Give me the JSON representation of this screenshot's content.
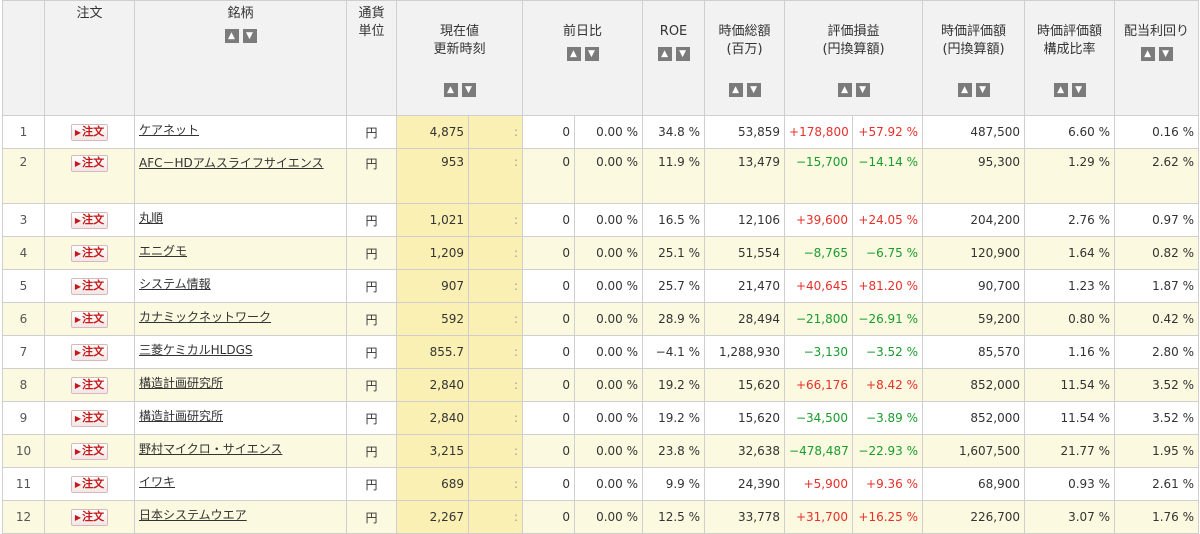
{
  "headers": {
    "order": "注文",
    "name": "銘柄",
    "currency": "通貨\n単位",
    "price": "現在値\n更新時刻",
    "change": "前日比",
    "roe": "ROE",
    "mktcap": "時価総額\n(百万)",
    "pnl": "評価損益\n(円換算額)",
    "valuation": "時価評価額\n(円換算額)",
    "ratio": "時価評価額\n構成比率",
    "dividend": "配当利回り"
  },
  "order_label": "注文",
  "currency_label": "円",
  "time_placeholder": ":",
  "rows": [
    {
      "idx": "1",
      "name": "ケアネット",
      "price": "4,875",
      "chg": "0",
      "chgpct": "0.00 %",
      "roe": "34.8 %",
      "cap": "53,859",
      "pnl": "+178,800",
      "pnlpct": "+57.92 %",
      "pnlsign": "pos",
      "val": "487,500",
      "ratio": "6.60 %",
      "div": "0.16 %"
    },
    {
      "idx": "2",
      "name": "AFC－HDアムスライフサイエンス",
      "price": "953",
      "chg": "0",
      "chgpct": "0.00 %",
      "roe": "11.9 %",
      "cap": "13,479",
      "pnl": "−15,700",
      "pnlpct": "−14.14 %",
      "pnlsign": "neg",
      "val": "95,300",
      "ratio": "1.29 %",
      "div": "2.62 %"
    },
    {
      "idx": "3",
      "name": "丸順",
      "price": "1,021",
      "chg": "0",
      "chgpct": "0.00 %",
      "roe": "16.5 %",
      "cap": "12,106",
      "pnl": "+39,600",
      "pnlpct": "+24.05 %",
      "pnlsign": "pos",
      "val": "204,200",
      "ratio": "2.76 %",
      "div": "0.97 %"
    },
    {
      "idx": "4",
      "name": "エニグモ",
      "price": "1,209",
      "chg": "0",
      "chgpct": "0.00 %",
      "roe": "25.1 %",
      "cap": "51,554",
      "pnl": "−8,765",
      "pnlpct": "−6.75 %",
      "pnlsign": "neg",
      "val": "120,900",
      "ratio": "1.64 %",
      "div": "0.82 %"
    },
    {
      "idx": "5",
      "name": "システム情報",
      "price": "907",
      "chg": "0",
      "chgpct": "0.00 %",
      "roe": "25.7 %",
      "cap": "21,470",
      "pnl": "+40,645",
      "pnlpct": "+81.20 %",
      "pnlsign": "pos",
      "val": "90,700",
      "ratio": "1.23 %",
      "div": "1.87 %"
    },
    {
      "idx": "6",
      "name": "カナミックネットワーク",
      "price": "592",
      "chg": "0",
      "chgpct": "0.00 %",
      "roe": "28.9 %",
      "cap": "28,494",
      "pnl": "−21,800",
      "pnlpct": "−26.91 %",
      "pnlsign": "neg",
      "val": "59,200",
      "ratio": "0.80 %",
      "div": "0.42 %"
    },
    {
      "idx": "7",
      "name": "三菱ケミカルHLDGS",
      "price": "855.7",
      "chg": "0",
      "chgpct": "0.00 %",
      "roe": "−4.1 %",
      "cap": "1,288,930",
      "pnl": "−3,130",
      "pnlpct": "−3.52 %",
      "pnlsign": "neg",
      "val": "85,570",
      "ratio": "1.16 %",
      "div": "2.80 %"
    },
    {
      "idx": "8",
      "name": "構造計画研究所",
      "price": "2,840",
      "chg": "0",
      "chgpct": "0.00 %",
      "roe": "19.2 %",
      "cap": "15,620",
      "pnl": "+66,176",
      "pnlpct": "+8.42 %",
      "pnlsign": "pos",
      "val": "852,000",
      "ratio": "11.54 %",
      "div": "3.52 %"
    },
    {
      "idx": "9",
      "name": "構造計画研究所",
      "price": "2,840",
      "chg": "0",
      "chgpct": "0.00 %",
      "roe": "19.2 %",
      "cap": "15,620",
      "pnl": "−34,500",
      "pnlpct": "−3.89 %",
      "pnlsign": "neg",
      "val": "852,000",
      "ratio": "11.54 %",
      "div": "3.52 %"
    },
    {
      "idx": "10",
      "name": "野村マイクロ・サイエンス",
      "price": "3,215",
      "chg": "0",
      "chgpct": "0.00 %",
      "roe": "23.8 %",
      "cap": "32,638",
      "pnl": "−478,487",
      "pnlpct": "−22.93 %",
      "pnlsign": "neg",
      "val": "1,607,500",
      "ratio": "21.77 %",
      "div": "1.95 %"
    },
    {
      "idx": "11",
      "name": "イワキ",
      "price": "689",
      "chg": "0",
      "chgpct": "0.00 %",
      "roe": "9.9 %",
      "cap": "24,390",
      "pnl": "+5,900",
      "pnlpct": "+9.36 %",
      "pnlsign": "pos",
      "val": "68,900",
      "ratio": "0.93 %",
      "div": "2.61 %"
    },
    {
      "idx": "12",
      "name": "日本システムウエア",
      "price": "2,267",
      "chg": "0",
      "chgpct": "0.00 %",
      "roe": "12.5 %",
      "cap": "33,778",
      "pnl": "+31,700",
      "pnlpct": "+16.25 %",
      "pnlsign": "pos",
      "val": "226,700",
      "ratio": "3.07 %",
      "div": "1.76 %"
    }
  ]
}
